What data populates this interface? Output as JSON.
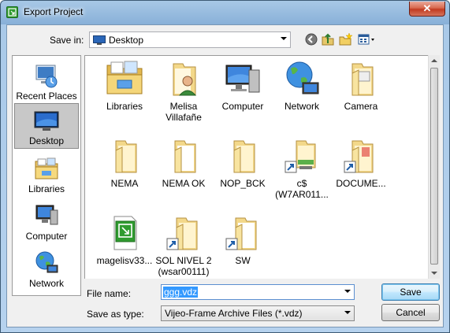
{
  "window": {
    "title": "Export Project",
    "close_glyph": "✕"
  },
  "toolbar": {
    "save_in_label": "Save in:",
    "location": "Desktop",
    "icons": [
      "back-icon",
      "up-folder-icon",
      "new-folder-icon",
      "views-menu-icon"
    ]
  },
  "places": [
    {
      "label": "Recent Places",
      "icon": "recent-places-icon",
      "selected": false
    },
    {
      "label": "Desktop",
      "icon": "desktop-icon",
      "selected": true
    },
    {
      "label": "Libraries",
      "icon": "libraries-icon",
      "selected": false
    },
    {
      "label": "Computer",
      "icon": "computer-icon",
      "selected": false
    },
    {
      "label": "Network",
      "icon": "network-icon",
      "selected": false
    }
  ],
  "files": [
    {
      "label": "Libraries",
      "icon": "libraries-icon"
    },
    {
      "label": "Melisa\nVillafañe",
      "icon": "user-folder-icon"
    },
    {
      "label": "Computer",
      "icon": "computer-icon"
    },
    {
      "label": "Network",
      "icon": "network-icon"
    },
    {
      "label": "Camera",
      "icon": "folder-icon"
    },
    {
      "label": "NEMA",
      "icon": "folder-icon"
    },
    {
      "label": "NEMA OK",
      "icon": "folder-icon"
    },
    {
      "label": "NOP_BCK",
      "icon": "folder-icon"
    },
    {
      "label": "c$\n(W7AR011...",
      "icon": "network-share-shortcut-icon"
    },
    {
      "label": "DOCUME...",
      "icon": "folder-shortcut-icon"
    },
    {
      "label": "magelisv33...",
      "icon": "vijeo-file-icon"
    },
    {
      "label": "SOL NIVEL 2\n(wsar00111)",
      "icon": "folder-shortcut-icon"
    },
    {
      "label": "SW",
      "icon": "folder-shortcut-icon"
    }
  ],
  "form": {
    "file_name_label": "File name:",
    "file_name_value": "ggg.vdz",
    "save_as_type_label": "Save as type:",
    "save_as_type_value": "Vijeo-Frame Archive Files (*.vdz)"
  },
  "buttons": {
    "save": "Save",
    "cancel": "Cancel"
  },
  "colors": {
    "selection": "#3399ff",
    "folder": "#f3d88a",
    "app_icon": "#2f9b2f"
  }
}
